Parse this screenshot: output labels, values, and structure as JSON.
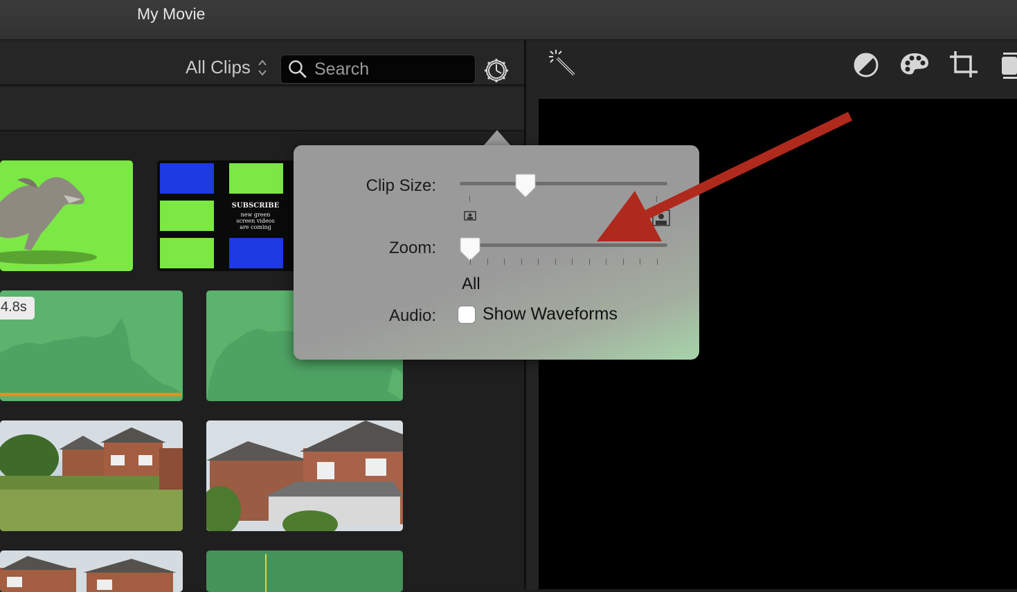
{
  "window": {
    "title": "My Movie"
  },
  "browser": {
    "filter_label": "All Clips",
    "search_placeholder": "Search"
  },
  "clips": [
    {
      "kind": "green-screen-dinosaur"
    },
    {
      "kind": "subscribe-grid",
      "text": [
        "SUBSCRIBE",
        "new green",
        "screen videos",
        "are coming"
      ]
    },
    {
      "kind": "audio-waveform",
      "duration": "4.8s"
    },
    {
      "kind": "audio-waveform"
    },
    {
      "kind": "house-garden"
    },
    {
      "kind": "house-conservatory"
    },
    {
      "kind": "house-row"
    },
    {
      "kind": "audio-green"
    }
  ],
  "popover": {
    "clip_size_label": "Clip Size:",
    "zoom_label": "Zoom:",
    "zoom_value_label": "All",
    "audio_label": "Audio:",
    "waveforms_label": "Show Waveforms",
    "waveforms_checked": false,
    "clip_size_level": 0.32,
    "zoom_level": 0.0
  },
  "viewer_tools": [
    "magic-wand-icon",
    "color-balance-icon",
    "color-palette-icon",
    "crop-icon",
    "stabilization-icon"
  ],
  "annotation": {
    "arrow_color": "#b0291d"
  }
}
